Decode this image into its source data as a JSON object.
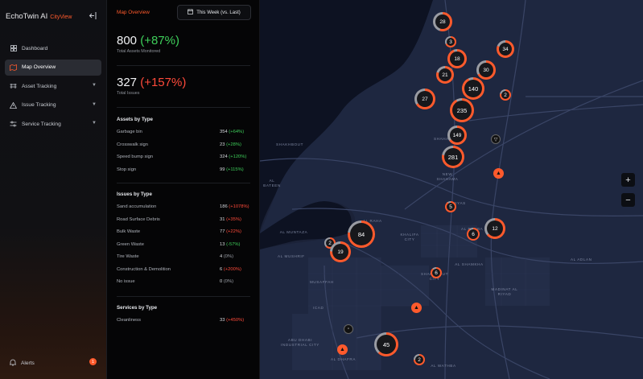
{
  "brand": {
    "name": "EchoTwin AI",
    "sub": "CityView"
  },
  "nav": [
    {
      "label": "Dashboard",
      "icon": "dashboard-icon",
      "active": false,
      "expandable": false
    },
    {
      "label": "Map Overview",
      "icon": "map-icon",
      "active": true,
      "expandable": false
    },
    {
      "label": "Asset Tracking",
      "icon": "asset-icon",
      "active": false,
      "expandable": true
    },
    {
      "label": "Issue Tracking",
      "icon": "warning-icon",
      "active": false,
      "expandable": true
    },
    {
      "label": "Service Tracking",
      "icon": "sliders-icon",
      "active": false,
      "expandable": true
    }
  ],
  "alerts": {
    "label": "Alerts",
    "count": "1"
  },
  "panel": {
    "title": "Map Overview",
    "range": "This Week (vs. Last)",
    "kpi_assets": {
      "value": "800",
      "delta": "(+87%)",
      "label": "Total Assets Monitored"
    },
    "kpi_issues": {
      "value": "327",
      "delta": "(+157%)",
      "label": "Total Issues"
    },
    "assets_title": "Assets by Type",
    "assets": [
      {
        "name": "Garbage bin",
        "value": "354",
        "delta": "(+64%)",
        "trend": "up"
      },
      {
        "name": "Crosswalk sign",
        "value": "23",
        "delta": "(+28%)",
        "trend": "up"
      },
      {
        "name": "Speed bump sign",
        "value": "324",
        "delta": "(+120%)",
        "trend": "up"
      },
      {
        "name": "Stop sign",
        "value": "99",
        "delta": "(+115%)",
        "trend": "up"
      }
    ],
    "issues_title": "Issues by Type",
    "issues": [
      {
        "name": "Sand accumulation",
        "value": "186",
        "delta": "(+1078%)",
        "trend": "down"
      },
      {
        "name": "Road Surface Debris",
        "value": "31",
        "delta": "(+35%)",
        "trend": "down"
      },
      {
        "name": "Bulk Waste",
        "value": "77",
        "delta": "(+22%)",
        "trend": "down"
      },
      {
        "name": "Green Waste",
        "value": "13",
        "delta": "(-57%)",
        "trend": "up"
      },
      {
        "name": "Tire Waste",
        "value": "4",
        "delta": "(0%)",
        "trend": "neutral"
      },
      {
        "name": "Construction & Demolition",
        "value": "6",
        "delta": "(+200%)",
        "trend": "down"
      },
      {
        "name": "No issue",
        "value": "0",
        "delta": "(0%)",
        "trend": "neutral"
      }
    ],
    "services_title": "Services by Type",
    "services": [
      {
        "name": "Cleanliness",
        "value": "33",
        "delta": "(+450%)",
        "trend": "down"
      }
    ]
  },
  "map": {
    "labels": [
      "SHAKHBOUT",
      "SHAHAMA",
      "NEW SHAHAMA",
      "BANIYAS",
      "AL RAHA",
      "KHALIFA CITY",
      "AL MUNTAZA",
      "AL MUSHRIF",
      "MUSAFFAH",
      "ICAD",
      "AL SHAMKHA",
      "MADINAT AL RIYAD",
      "AL ADLAN",
      "ABU DHABI INDUSTRIAL CITY",
      "AL DHAFRA",
      "AL WATHBA",
      "SHAKHBOUT CITY",
      "AL BATEEN",
      "AL RAHBA"
    ],
    "clusters": [
      "28",
      "3",
      "34",
      "18",
      "30",
      "21",
      "140",
      "27",
      "2",
      "235",
      "149",
      "281",
      "5",
      "12",
      "84",
      "6",
      "2",
      "19",
      "6",
      "45",
      "2"
    ],
    "zoom_in": "+",
    "zoom_out": "−"
  },
  "colors": {
    "accent": "#ff5a2c",
    "up": "#3ecf5a",
    "down": "#ff4a3a"
  }
}
